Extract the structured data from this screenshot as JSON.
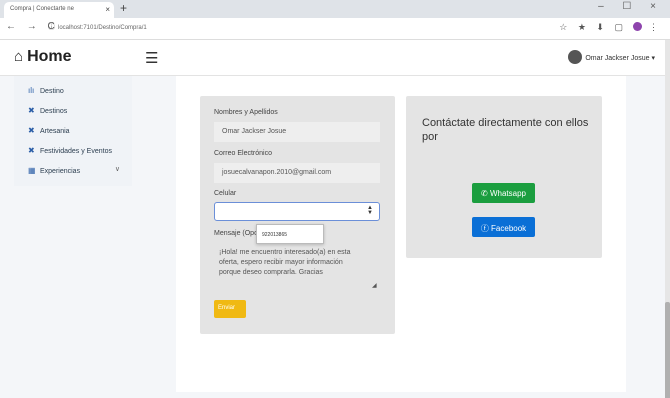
{
  "browser": {
    "tab_title": "Compra | Conectarte ne",
    "tab_close": "×",
    "new_tab": "+",
    "window_controls": "– ☐ ×",
    "nav_buttons": "← → C",
    "url": "localhost:7101/Destino/Compra/1",
    "toolbar_icons": "☆ ★ ⬇ ▢"
  },
  "header": {
    "home_label": "Home",
    "user_name": "Omar Jackser Josue ▾"
  },
  "sidebar": {
    "items": [
      {
        "label": "Destino",
        "icon": "ılı"
      },
      {
        "label": "Destinos",
        "icon": "✖"
      },
      {
        "label": "Artesania",
        "icon": "✖"
      },
      {
        "label": "Festividades y Eventos",
        "icon": "✖"
      },
      {
        "label": "Experiencias",
        "icon": "▦"
      }
    ],
    "chevron": "∨"
  },
  "form": {
    "name_label": "Nombres y Apellidos",
    "name_value": "Omar Jackser Josue",
    "email_label": "Correo Electrónico",
    "email_value": "josuecalvanapon.2010@gmail.com",
    "phone_label": "Celular",
    "phone_value": "",
    "autocomplete": "922013865",
    "message_label": "Mensaje (Opc",
    "message_lines": [
      "¡Hola! me encuentro interesado(a) en esta",
      "oferta, espero recibir mayor información",
      "porque deseo comprarla. Gracias"
    ],
    "submit_label": "Enviar"
  },
  "contact": {
    "title_line1": "Contáctate directamente con ellos",
    "title_line2": "por",
    "whatsapp_label": "Whatsapp",
    "facebook_label": "Facebook"
  },
  "colors": {
    "whatsapp": "#1b9e3f",
    "facebook": "#0a6fd6",
    "submit": "#f0b913"
  }
}
